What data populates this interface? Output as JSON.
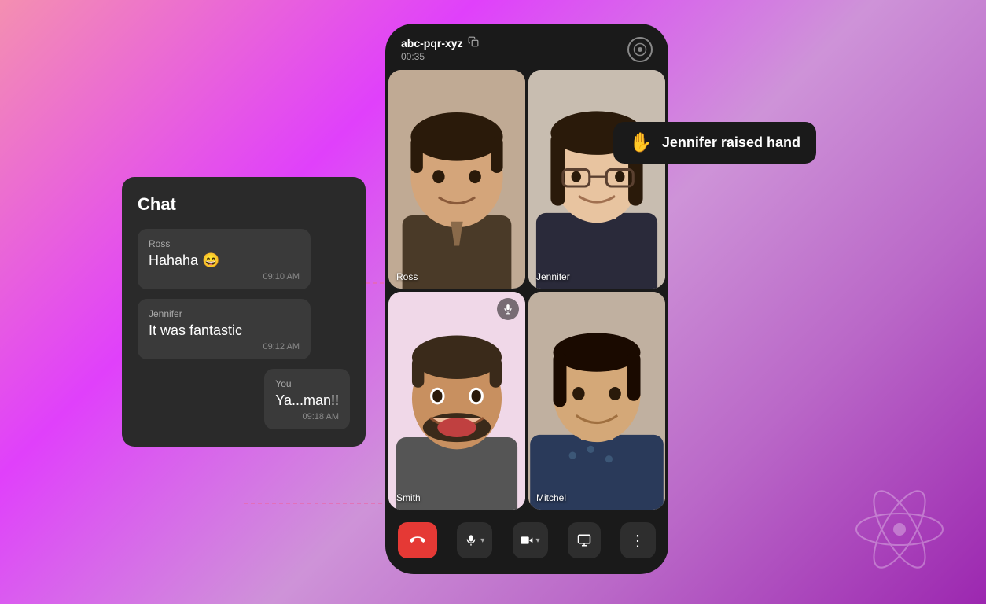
{
  "background": {
    "gradient_start": "#f48fb1",
    "gradient_end": "#9c27b0"
  },
  "chat": {
    "title": "Chat",
    "messages": [
      {
        "sender": "Ross",
        "text": "Hahaha 😄",
        "time": "09:10 AM",
        "is_self": false
      },
      {
        "sender": "Jennifer",
        "text": "It was fantastic",
        "time": "09:12 AM",
        "is_self": false
      },
      {
        "sender": "You",
        "text": "Ya...man!!",
        "time": "09:18 AM",
        "is_self": true
      }
    ]
  },
  "call": {
    "id": "abc-pqr-xyz",
    "timer": "00:35",
    "participants": [
      {
        "name": "Ross",
        "position": "top-left",
        "has_mic": false,
        "bg": "#c8b89a"
      },
      {
        "name": "Jennifer",
        "position": "top-right",
        "has_mic": false,
        "bg": "#d4c4b0"
      },
      {
        "name": "Smith",
        "position": "bottom-left",
        "has_mic": true,
        "bg": "#f0e0d0"
      },
      {
        "name": "Mitchel",
        "position": "bottom-right",
        "has_mic": false,
        "bg": "#d8c8b8"
      }
    ]
  },
  "controls": [
    {
      "id": "end-call",
      "icon": "📞",
      "label": "End call"
    },
    {
      "id": "mic",
      "icon": "🎤",
      "label": "Microphone",
      "has_chevron": true
    },
    {
      "id": "camera",
      "icon": "📹",
      "label": "Camera",
      "has_chevron": true
    },
    {
      "id": "screen",
      "icon": "⬜",
      "label": "Screen share"
    },
    {
      "id": "more",
      "icon": "⋮",
      "label": "More options"
    }
  ],
  "toast": {
    "icon": "✋",
    "text": "Jennifer raised hand"
  },
  "icons": {
    "copy": "📋",
    "record": "⊙"
  }
}
